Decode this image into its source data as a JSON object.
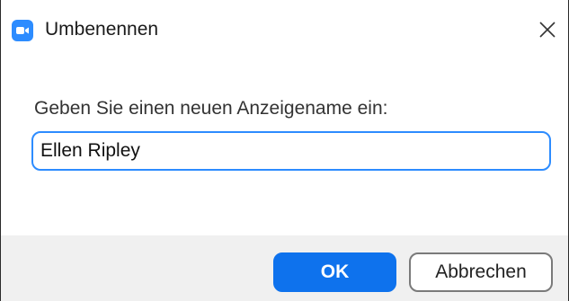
{
  "dialog": {
    "title": "Umbenennen",
    "app_icon": "zoom-camera-icon",
    "close_icon": "close-icon",
    "prompt": "Geben Sie einen neuen Anzeigename ein:",
    "name_value": "Ellen Ripley",
    "ok_label": "OK",
    "cancel_label": "Abbrechen"
  },
  "colors": {
    "accent": "#2d8cff",
    "ok_button": "#0e72ed",
    "footer_bg": "#f0f0f0"
  }
}
